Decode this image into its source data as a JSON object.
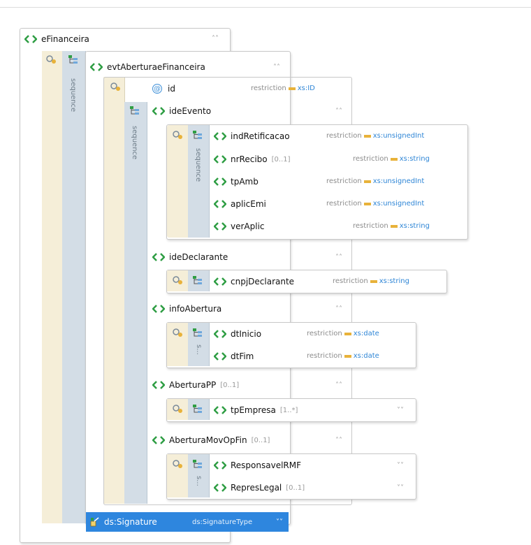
{
  "schema": {
    "root": {
      "name": "eFinanceira"
    },
    "event": {
      "name": "evtAberturaeFinanceira"
    },
    "sequence_label": "sequence",
    "sequence_short": "s...",
    "id_attr": {
      "name": "id",
      "restriction": "restriction",
      "type": "xs:ID"
    },
    "ideEvento": {
      "name": "ideEvento",
      "children": [
        {
          "name": "indRetificacao",
          "occ": "",
          "restriction": "restriction",
          "type": "xs:unsignedInt"
        },
        {
          "name": "nrRecibo",
          "occ": "[0..1]",
          "restriction": "restriction",
          "type": "xs:string"
        },
        {
          "name": "tpAmb",
          "occ": "",
          "restriction": "restriction",
          "type": "xs:unsignedInt"
        },
        {
          "name": "aplicEmi",
          "occ": "",
          "restriction": "restriction",
          "type": "xs:unsignedInt"
        },
        {
          "name": "verAplic",
          "occ": "",
          "restriction": "restriction",
          "type": "xs:string"
        }
      ]
    },
    "ideDeclarante": {
      "name": "ideDeclarante",
      "child": {
        "name": "cnpjDeclarante",
        "restriction": "restriction",
        "type": "xs:string"
      }
    },
    "infoAbertura": {
      "name": "infoAbertura",
      "children": [
        {
          "name": "dtInicio",
          "restriction": "restriction",
          "type": "xs:date"
        },
        {
          "name": "dtFim",
          "restriction": "restriction",
          "type": "xs:date"
        }
      ]
    },
    "aberturaPP": {
      "name": "AberturaPP",
      "occ": "[0..1]",
      "child": {
        "name": "tpEmpresa",
        "occ": "[1..*]"
      }
    },
    "aberturaMovOpFin": {
      "name": "AberturaMovOpFin",
      "occ": "[0..1]",
      "children": [
        {
          "name": "ResponsavelRMF",
          "occ": ""
        },
        {
          "name": "RepresLegal",
          "occ": "[0..1]"
        }
      ]
    },
    "signature": {
      "name": "ds:Signature",
      "type": "ds:SignatureType"
    }
  },
  "colors": {
    "element_icon": "#2f9e44",
    "type_link": "#2f86d6",
    "restriction_arrow": "#e8b23a",
    "signature_bg": "#2e86de"
  }
}
